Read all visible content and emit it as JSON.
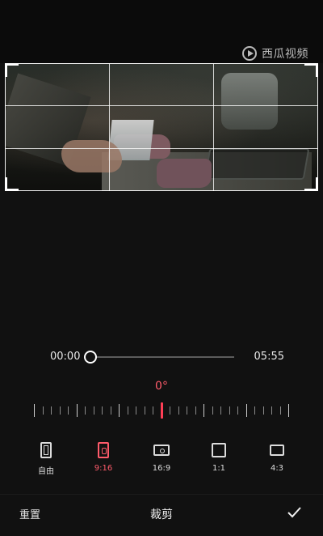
{
  "watermark": {
    "text": "西瓜视频"
  },
  "timeline": {
    "current": "00:00",
    "total": "05:55",
    "progress": 0.0
  },
  "rotation": {
    "angle": "0°",
    "tick_count": 31,
    "marker_index": 15
  },
  "ratios": [
    {
      "label": "自由",
      "icon": "free-crop-icon",
      "active": false
    },
    {
      "label": "9:16",
      "icon": "ratio-9-16-icon",
      "active": true
    },
    {
      "label": "16:9",
      "icon": "ratio-16-9-icon",
      "active": false
    },
    {
      "label": "1:1",
      "icon": "ratio-1-1-icon",
      "active": false
    },
    {
      "label": "4:3",
      "icon": "ratio-4-3-icon",
      "active": false
    }
  ],
  "bottombar": {
    "reset": "重置",
    "title": "裁剪"
  },
  "colors": {
    "accent": "#ff5b6b",
    "background": "#111111"
  }
}
